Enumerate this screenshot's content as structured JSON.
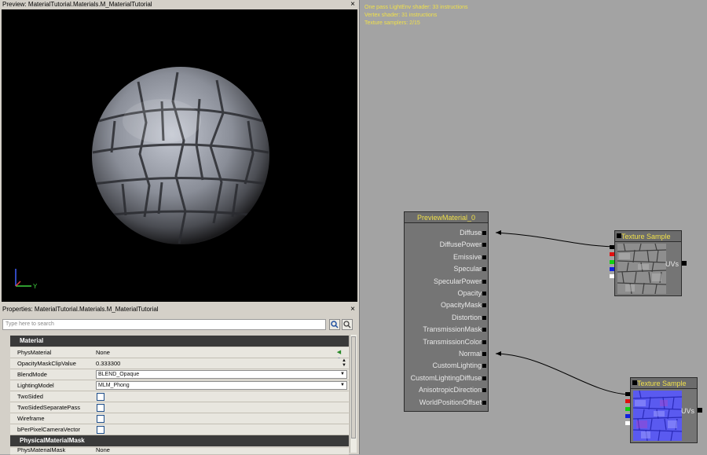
{
  "preview": {
    "title": "Preview: MaterialTutorial.Materials.M_MaterialTutorial",
    "close": "×",
    "axis_y": "Y"
  },
  "properties": {
    "title": "Properties: MaterialTutorial.Materials.M_MaterialTutorial",
    "close": "×",
    "search_placeholder": "Type here to search",
    "categories": [
      "Material",
      "PhysicalMaterialMask"
    ],
    "rows": [
      {
        "name": "PhysMaterial",
        "value": "None",
        "kind": "text"
      },
      {
        "name": "OpacityMaskClipValue",
        "value": "0.333300",
        "kind": "spin"
      },
      {
        "name": "BlendMode",
        "value": "BLEND_Opaque",
        "kind": "select"
      },
      {
        "name": "LightingModel",
        "value": "MLM_Phong",
        "kind": "select"
      },
      {
        "name": "TwoSided",
        "value": "",
        "kind": "check"
      },
      {
        "name": "TwoSidedSeparatePass",
        "value": "",
        "kind": "check"
      },
      {
        "name": "Wireframe",
        "value": "",
        "kind": "check"
      },
      {
        "name": "bPerPixelCameraVector",
        "value": "",
        "kind": "check"
      }
    ],
    "mask_row": {
      "name": "PhysMaterialMask",
      "value": "None"
    }
  },
  "graph": {
    "stats": [
      "One pass LightEnv shader: 33 instructions",
      "Vertex shader: 31 instructions",
      "Texture samplers: 2/15"
    ],
    "material_node": {
      "title": "PreviewMaterial_0",
      "inputs": [
        "Diffuse",
        "DiffusePower",
        "Emissive",
        "Specular",
        "SpecularPower",
        "Opacity",
        "OpacityMask",
        "Distortion",
        "TransmissionMask",
        "TransmissionColor",
        "Normal",
        "CustomLighting",
        "CustomLightingDiffuse",
        "AnisotropicDirection",
        "WorldPositionOffset"
      ]
    },
    "texture_nodes": [
      {
        "title": "Texture Sample",
        "output": "UVs",
        "kind": "diffuse"
      },
      {
        "title": "Texture Sample",
        "output": "UVs",
        "kind": "normal"
      }
    ],
    "colors": {
      "title_text": "#f0e04a",
      "node_bg": "#757575",
      "canvas": "#a3a3a3"
    }
  }
}
